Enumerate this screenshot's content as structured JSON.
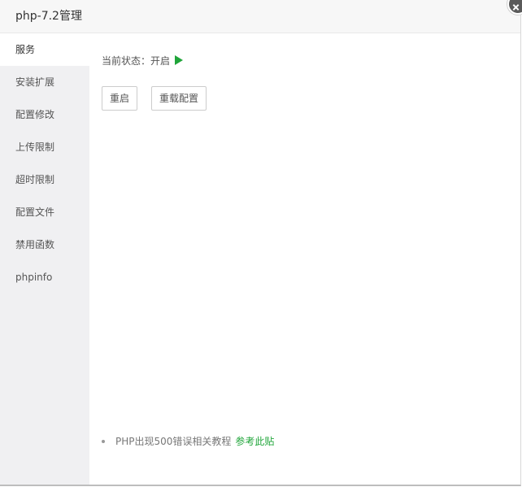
{
  "dialog": {
    "title": "php-7.2管理"
  },
  "sidebar": {
    "items": [
      {
        "label": "服务"
      },
      {
        "label": "安装扩展"
      },
      {
        "label": "配置修改"
      },
      {
        "label": "上传限制"
      },
      {
        "label": "超时限制"
      },
      {
        "label": "配置文件"
      },
      {
        "label": "禁用函数"
      },
      {
        "label": "phpinfo"
      }
    ]
  },
  "service": {
    "status_label": "当前状态：",
    "status_value": "开启",
    "status_icon": "play-icon",
    "status_color": "#20a53a",
    "restart_label": "重启",
    "reload_label": "重载配置"
  },
  "tips": {
    "text": "PHP出现500错误相关教程",
    "link_label": "参考此贴",
    "link_color": "#20a53a"
  }
}
